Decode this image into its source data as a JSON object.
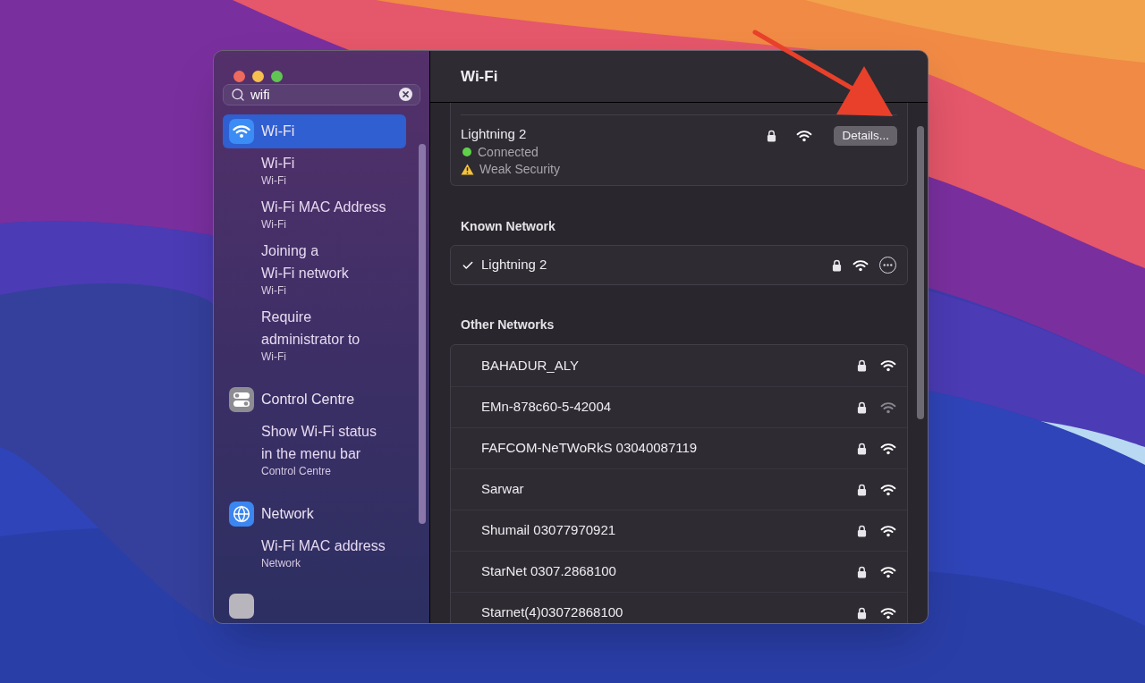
{
  "window": {
    "controls": [
      {
        "kind": "close"
      },
      {
        "kind": "minimize"
      },
      {
        "kind": "zoom"
      }
    ]
  },
  "sidebar": {
    "search": {
      "value": "wifi"
    },
    "panes": [
      {
        "kind": "wifi",
        "title": "Wi-Fi",
        "selected": true,
        "results": [
          {
            "lines": [
              "Wi-Fi"
            ],
            "subtitle": "Wi-Fi",
            "selected": false
          },
          {
            "lines": [
              "Wi-Fi MAC Address"
            ],
            "subtitle": "Wi-Fi",
            "selected": false
          },
          {
            "lines": [
              "Joining a",
              "Wi-Fi network"
            ],
            "subtitle": "Wi-Fi",
            "selected": false
          },
          {
            "lines": [
              "Require",
              "administrator to"
            ],
            "subtitle": "Wi-Fi",
            "selected": false
          }
        ]
      },
      {
        "kind": "toggles",
        "title": "Control Centre",
        "selected": false,
        "results": [
          {
            "lines": [
              "Show Wi-Fi status",
              "in the menu bar"
            ],
            "subtitle": "Control Centre",
            "selected": false
          }
        ]
      },
      {
        "kind": "globe",
        "title": "Network",
        "selected": false,
        "results": [
          {
            "lines": [
              "Wi-Fi MAC address"
            ],
            "subtitle": "Network",
            "selected": false
          }
        ]
      },
      {
        "kind": "generic",
        "selected": false
      }
    ]
  },
  "content": {
    "title": "Wi-Fi",
    "current": {
      "name": "Lightning 2",
      "status": "Connected",
      "warning": "Weak Security",
      "locked": true,
      "button": "Details..."
    },
    "known": {
      "heading": "Known Network",
      "networks": [
        {
          "name": "Lightning 2",
          "checked": true,
          "locked": true
        }
      ]
    },
    "other": {
      "heading": "Other Networks",
      "networks": [
        {
          "name": "BAHADUR_ALY",
          "locked": true,
          "weak_signal": false
        },
        {
          "name": "EMn-878c60-5-42004",
          "locked": true,
          "weak_signal": true
        },
        {
          "name": "FAFCOM-NeTWoRkS 03040087119",
          "locked": true,
          "weak_signal": false
        },
        {
          "name": "Sarwar",
          "locked": true,
          "weak_signal": false
        },
        {
          "name": "Shumail 03077970921",
          "locked": true,
          "weak_signal": false
        },
        {
          "name": "StarNet 0307.2868100",
          "locked": true,
          "weak_signal": false
        },
        {
          "name": "Starnet(4)03072868100",
          "locked": true,
          "weak_signal": false
        }
      ]
    }
  }
}
